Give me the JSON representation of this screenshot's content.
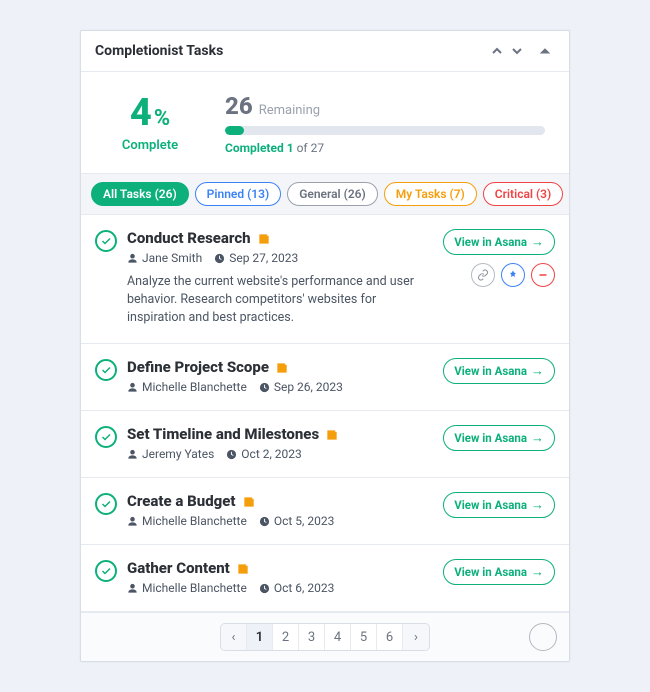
{
  "header": {
    "title": "Completionist Tasks"
  },
  "summary": {
    "percent": "4",
    "percent_sign": "%",
    "complete_label": "Complete",
    "remaining_num": "26",
    "remaining_label": "Remaining",
    "progress_prefix": "Completed ",
    "progress_done": "1",
    "progress_mid": " of ",
    "progress_total": "27"
  },
  "filters": [
    {
      "label": "All Tasks (26)",
      "style": "active"
    },
    {
      "label": "Pinned (13)",
      "style": "blue"
    },
    {
      "label": "General (26)",
      "style": "gray"
    },
    {
      "label": "My Tasks (7)",
      "style": "orange"
    },
    {
      "label": "Critical (3)",
      "style": "red"
    }
  ],
  "view_label": "View in Asana",
  "tasks": [
    {
      "title": "Conduct Research",
      "assignee": "Jane Smith",
      "date": "Sep 27, 2023",
      "desc": "Analyze the current website's performance and user behavior. Research competitors' websites for inspiration and best practices.",
      "expanded": true
    },
    {
      "title": "Define Project Scope",
      "assignee": "Michelle Blanchette",
      "date": "Sep 26, 2023"
    },
    {
      "title": "Set Timeline and Milestones",
      "assignee": "Jeremy Yates",
      "date": "Oct 2, 2023"
    },
    {
      "title": "Create a Budget",
      "assignee": "Michelle Blanchette",
      "date": "Oct 5, 2023"
    },
    {
      "title": "Gather Content",
      "assignee": "Michelle Blanchette",
      "date": "Oct 6, 2023"
    }
  ],
  "pages": [
    "1",
    "2",
    "3",
    "4",
    "5",
    "6"
  ]
}
